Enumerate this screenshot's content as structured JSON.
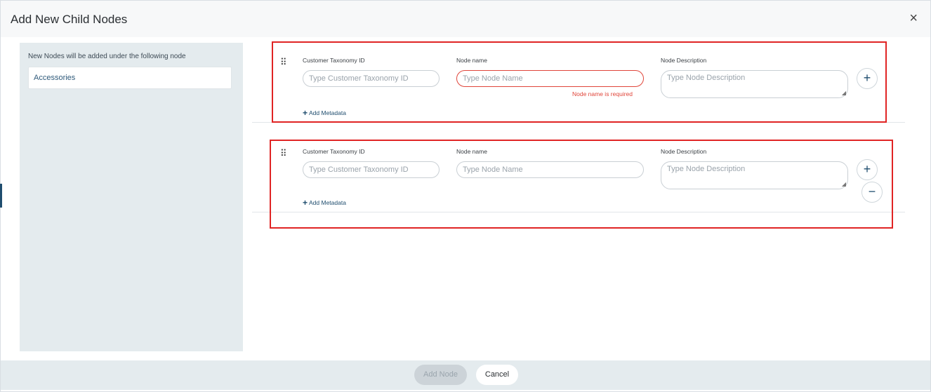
{
  "dialog": {
    "title": "Add New Child Nodes",
    "close_glyph": "×"
  },
  "parent": {
    "label": "New Nodes will be added under the following node",
    "value": "Accessories"
  },
  "rows": [
    {
      "taxonomy_label": "Customer Taxonomy ID",
      "taxonomy_placeholder": "Type Customer Taxonomy ID",
      "name_label": "Node name",
      "name_placeholder": "Type Node Name",
      "name_error": "Node name is required",
      "desc_label": "Node Description",
      "desc_placeholder": "Type Node Description",
      "add_metadata": "Add Metadata"
    },
    {
      "taxonomy_label": "Customer Taxonomy ID",
      "taxonomy_placeholder": "Type Customer Taxonomy ID",
      "name_label": "Node name",
      "name_placeholder": "Type Node Name",
      "desc_label": "Node Description",
      "desc_placeholder": "Type Node Description",
      "add_metadata": "Add Metadata"
    }
  ],
  "icons": {
    "drag": "drag-handle-icon",
    "add": "plus-icon",
    "remove": "minus-icon"
  },
  "footer": {
    "add_node": "Add Node",
    "cancel": "Cancel"
  },
  "colors": {
    "error": "#e0453a",
    "highlight": "#e02424",
    "accent": "#1f4d6e",
    "panel": "#e4ebee"
  }
}
